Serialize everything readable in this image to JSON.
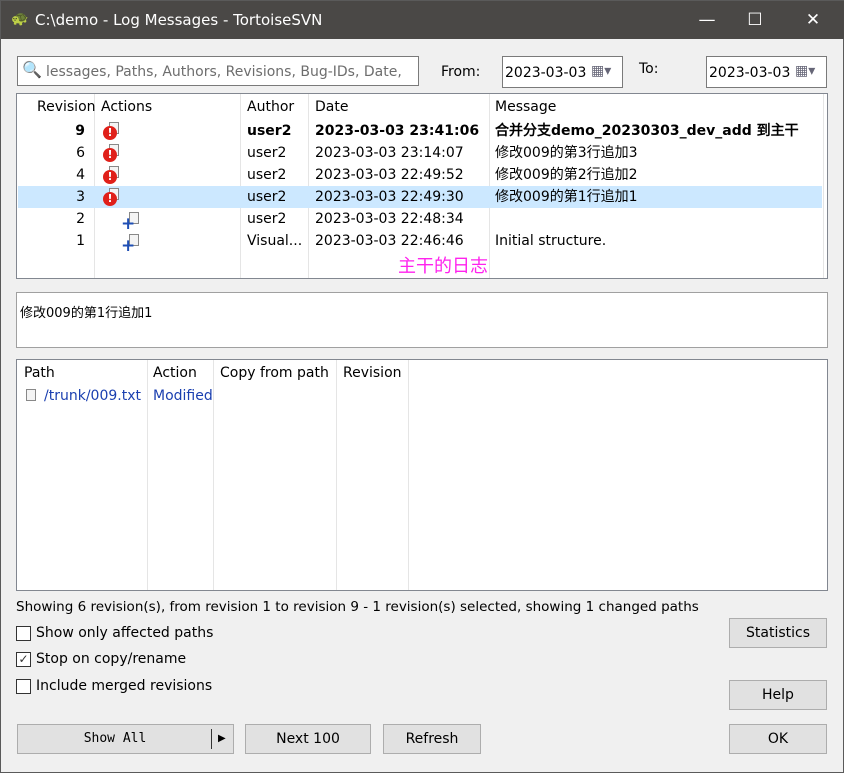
{
  "window": {
    "title": "C:\\demo - Log Messages - TortoiseSVN",
    "minimize": "—",
    "maximize": "☐",
    "close": "✕"
  },
  "filter": {
    "search_placeholder": "lessages, Paths, Authors, Revisions, Bug-IDs, Date,",
    "from_label": "From:",
    "from_value": "2023-03-03",
    "to_label": "To:",
    "to_value": "2023-03-03"
  },
  "log": {
    "columns": [
      "Revision",
      "Actions",
      "Author",
      "Date",
      "Message"
    ],
    "rows": [
      {
        "revision": "9",
        "action": "modified",
        "author": "user2",
        "date": "2023-03-03 23:41:06",
        "message": "合并分支demo_20230303_dev_add 到主干",
        "bold": true
      },
      {
        "revision": "6",
        "action": "modified",
        "author": "user2",
        "date": "2023-03-03 23:14:07",
        "message": "修改009的第3行追加3"
      },
      {
        "revision": "4",
        "action": "modified",
        "author": "user2",
        "date": "2023-03-03 22:49:52",
        "message": "修改009的第2行追加2"
      },
      {
        "revision": "3",
        "action": "modified",
        "author": "user2",
        "date": "2023-03-03 22:49:30",
        "message": "修改009的第1行追加1",
        "selected": true
      },
      {
        "revision": "2",
        "action": "added",
        "author": "user2",
        "date": "2023-03-03 22:48:34",
        "message": ""
      },
      {
        "revision": "1",
        "action": "added",
        "author": "Visual...",
        "date": "2023-03-03 22:46:46",
        "message": "Initial structure."
      }
    ],
    "annotation": "主干的日志",
    "annotation_color": "#ff22ee"
  },
  "message_text": "修改009的第1行追加1",
  "paths": {
    "columns": [
      "Path",
      "Action",
      "Copy from path",
      "Revision"
    ],
    "rows": [
      {
        "path": "/trunk/009.txt",
        "action": "Modified",
        "copy_from": "",
        "revision": ""
      }
    ]
  },
  "status": "Showing 6 revision(s), from revision 1 to revision 9 - 1 revision(s) selected, showing 1 changed paths",
  "options": [
    {
      "label": "Show only affected paths",
      "checked": false
    },
    {
      "label": "Stop on copy/rename",
      "checked": true
    },
    {
      "label": "Include merged revisions",
      "checked": false
    }
  ],
  "buttons": {
    "statistics": "Statistics",
    "help": "Help",
    "show_all": "Show All",
    "next": "Next 100",
    "refresh": "Refresh",
    "ok": "OK"
  }
}
